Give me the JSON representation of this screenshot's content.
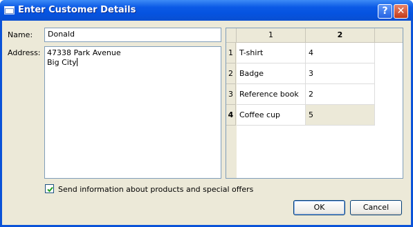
{
  "window": {
    "title": "Enter Customer Details",
    "help_label": "?",
    "close_label": "✕"
  },
  "form": {
    "name_label": "Name:",
    "name_value": "Donald",
    "address_label": "Address:",
    "address_line1": "47338 Park Avenue",
    "address_line2": "Big City",
    "checkbox_label": "Send information about products and special offers",
    "checkbox_checked": true
  },
  "table": {
    "columns": [
      "1",
      "2"
    ],
    "rows": [
      {
        "header": "1",
        "item": "T-shirt",
        "qty": "4"
      },
      {
        "header": "2",
        "item": "Badge",
        "qty": "3"
      },
      {
        "header": "3",
        "item": "Reference book",
        "qty": "2"
      },
      {
        "header": "4",
        "item": "Coffee cup",
        "qty": "5"
      }
    ],
    "selected_column": "2",
    "selected_row": "4"
  },
  "buttons": {
    "ok_label": "OK",
    "cancel_label": "Cancel"
  },
  "colors": {
    "titlebar": "#0553e0",
    "dialog_bg": "#ece9d8",
    "field_border": "#7f9db9",
    "checkmark": "#21a121"
  }
}
